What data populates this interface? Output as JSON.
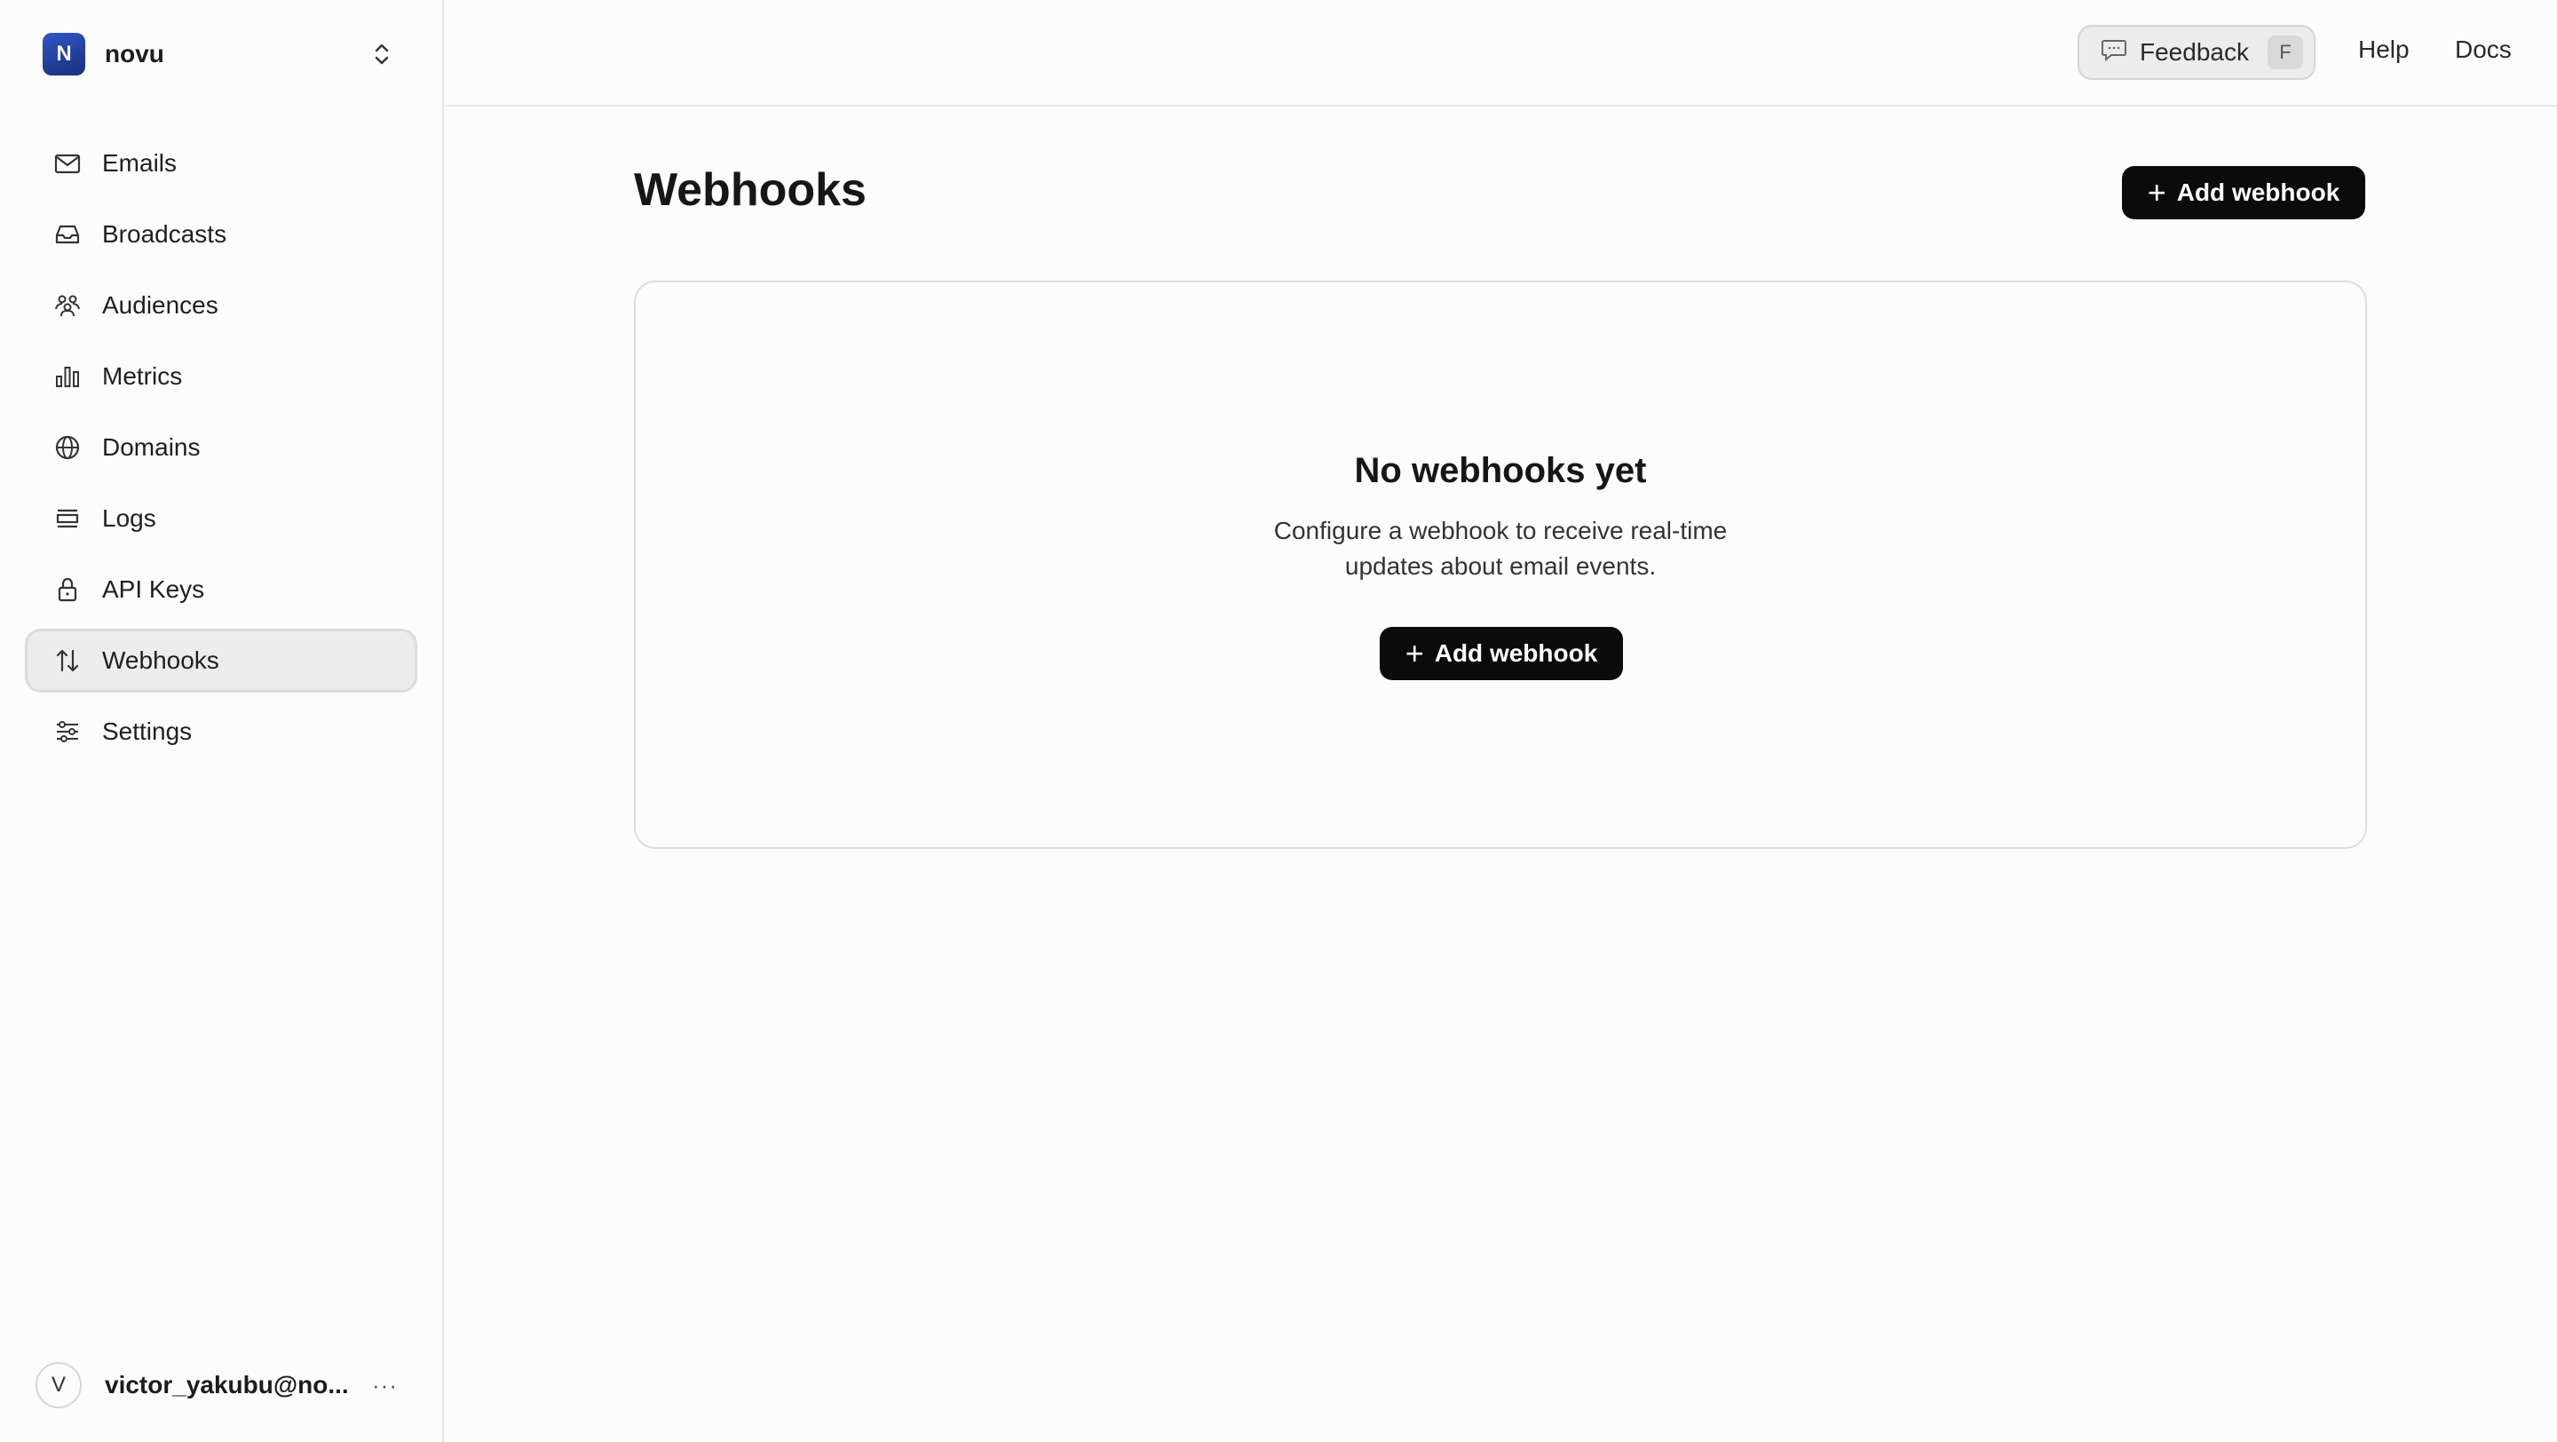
{
  "team": {
    "initial": "N",
    "name": "novu"
  },
  "sidebar": {
    "items": [
      {
        "label": "Emails",
        "icon": "mail-icon"
      },
      {
        "label": "Broadcasts",
        "icon": "inbox-icon"
      },
      {
        "label": "Audiences",
        "icon": "users-icon"
      },
      {
        "label": "Metrics",
        "icon": "bar-chart-icon"
      },
      {
        "label": "Domains",
        "icon": "globe-icon"
      },
      {
        "label": "Logs",
        "icon": "logs-icon"
      },
      {
        "label": "API Keys",
        "icon": "lock-icon"
      },
      {
        "label": "Webhooks",
        "icon": "arrows-up-down-icon",
        "active": true
      },
      {
        "label": "Settings",
        "icon": "sliders-icon"
      }
    ]
  },
  "user": {
    "initial": "V",
    "email": "victor_yakubu@no...",
    "more": "···"
  },
  "topbar": {
    "feedback_label": "Feedback",
    "feedback_shortcut": "F",
    "help_label": "Help",
    "docs_label": "Docs"
  },
  "main": {
    "title": "Webhooks",
    "add_button_label": "Add webhook",
    "empty": {
      "title": "No webhooks yet",
      "description": "Configure a webhook to receive real-time updates about email events.",
      "add_button_label": "Add webhook"
    }
  }
}
